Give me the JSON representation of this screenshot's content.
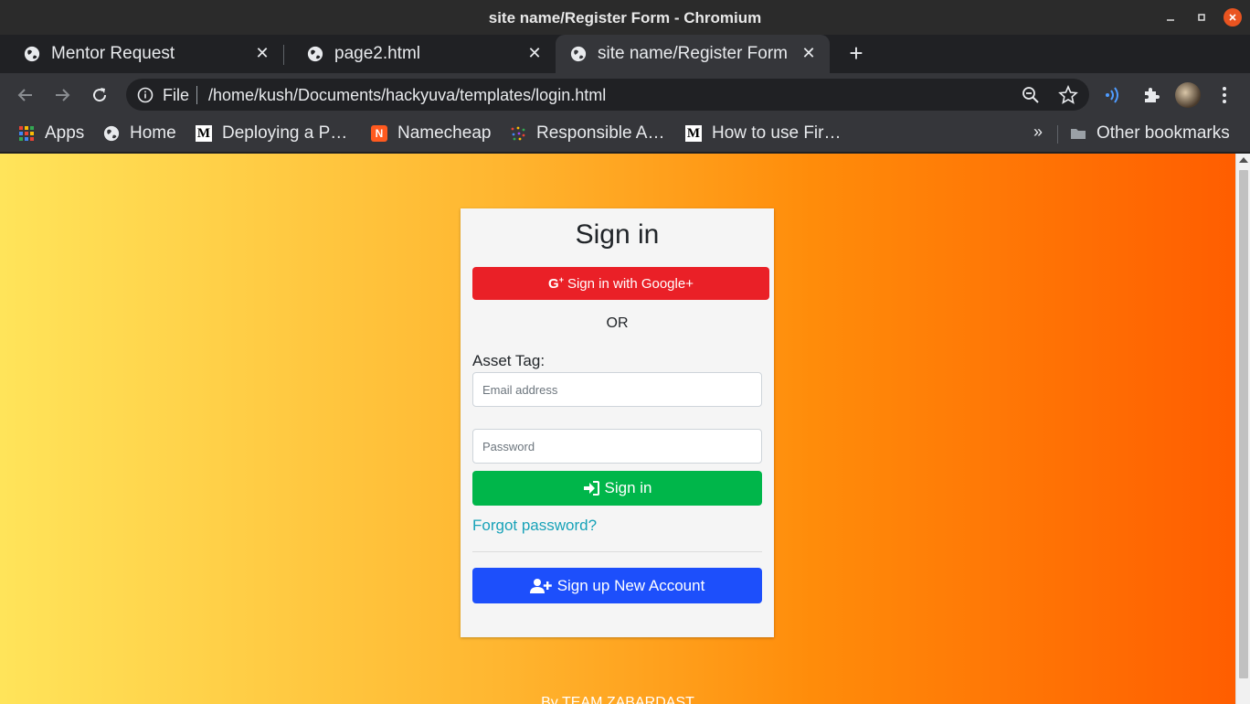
{
  "window": {
    "title": "site name/Register Form - Chromium"
  },
  "tabs": [
    {
      "label": "Mentor Request"
    },
    {
      "label": "page2.html"
    },
    {
      "label": "site name/Register Form"
    }
  ],
  "omnibox": {
    "scheme": "File",
    "url": "/home/kush/Documents/hackyuva/templates/login.html"
  },
  "bookmarks": [
    {
      "label": "Apps"
    },
    {
      "label": "Home"
    },
    {
      "label": "Deploying a P…"
    },
    {
      "label": "Namecheap"
    },
    {
      "label": "Responsible A…"
    },
    {
      "label": "How to use Fir…"
    }
  ],
  "bookmarks_overflow": "»",
  "other_bookmarks": "Other bookmarks",
  "form": {
    "title": "Sign in",
    "google_label": "Sign in with Google+",
    "or": "OR",
    "asset_label": "Asset Tag:",
    "email_placeholder": "Email address",
    "password_placeholder": "Password",
    "signin_label": "Sign in",
    "forgot_label": "Forgot password?",
    "signup_label": "Sign up New Account"
  },
  "footer": {
    "text": "By TEAM ZABARDAST"
  },
  "colors": {
    "google": "#ea2027",
    "signin": "#00b64a",
    "signup": "#1d4ffb",
    "link": "#17a2b8"
  }
}
